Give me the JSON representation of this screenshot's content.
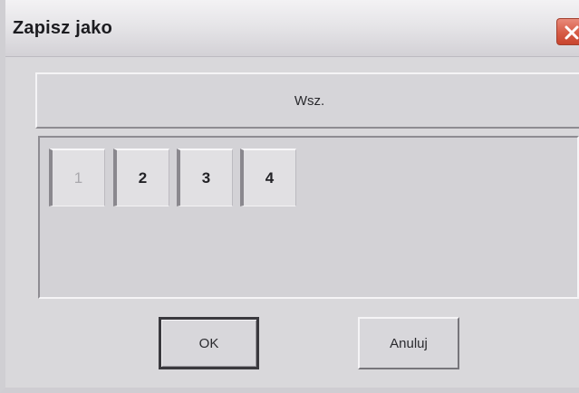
{
  "dialog": {
    "title": "Zapisz jako",
    "close_icon": "close-icon"
  },
  "group_button": {
    "label": "Wsz."
  },
  "pages": [
    {
      "label": "1",
      "enabled": false
    },
    {
      "label": "2",
      "enabled": true
    },
    {
      "label": "3",
      "enabled": true
    },
    {
      "label": "4",
      "enabled": true
    }
  ],
  "buttons": {
    "ok_label": "OK",
    "cancel_label": "Anuluj"
  },
  "colors": {
    "close_button": "#d65b45",
    "window_bg": "#d9d8db"
  }
}
